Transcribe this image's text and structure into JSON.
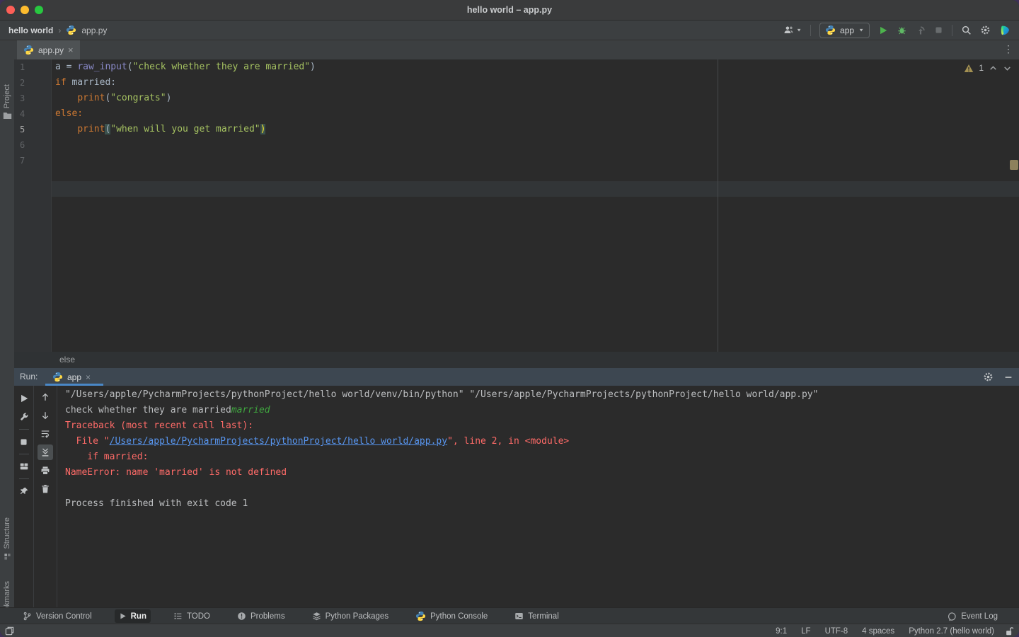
{
  "window": {
    "title": "hello world – app.py"
  },
  "navbar": {
    "project": "hello world",
    "separator": "›",
    "file": "app.py",
    "run_config": "app"
  },
  "tabbar": {
    "tab": "app.py",
    "close": "×",
    "more": "⋮"
  },
  "stripe": {
    "items": [
      {
        "label": "Project",
        "icon": "folder"
      },
      {
        "label": "Structure",
        "icon": "structure"
      },
      {
        "label": "Bookmarks",
        "icon": "bookmark"
      }
    ]
  },
  "editor": {
    "active_line": 5,
    "warning_count": "1",
    "breadcrumb": "else",
    "lines": [
      {
        "num": "1",
        "segs": [
          {
            "t": "a = ",
            "c": "plain"
          },
          {
            "t": "raw_input",
            "c": "builtin"
          },
          {
            "t": "(",
            "c": "plain"
          },
          {
            "t": "\"check whether they are married\"",
            "c": "string"
          },
          {
            "t": ")",
            "c": "plain"
          }
        ]
      },
      {
        "num": "2",
        "segs": [
          {
            "t": "if",
            "c": "keyword"
          },
          {
            "t": " married:",
            "c": "plain"
          }
        ]
      },
      {
        "num": "3",
        "segs": [
          {
            "t": "    ",
            "c": "plain"
          },
          {
            "t": "print",
            "c": "keyword"
          },
          {
            "t": "(",
            "c": "plain"
          },
          {
            "t": "\"congrats\"",
            "c": "string"
          },
          {
            "t": ")",
            "c": "plain"
          }
        ]
      },
      {
        "num": "4",
        "segs": [
          {
            "t": "else:",
            "c": "keyword"
          }
        ]
      },
      {
        "num": "5",
        "segs": [
          {
            "t": "    ",
            "c": "plain"
          },
          {
            "t": "print",
            "c": "keyword"
          },
          {
            "t": "(",
            "c": "paren"
          },
          {
            "t": "\"when will you get married\"",
            "c": "string"
          },
          {
            "t": ")",
            "c": "paren_y"
          }
        ]
      },
      {
        "num": "6",
        "segs": []
      },
      {
        "num": "7",
        "segs": []
      }
    ]
  },
  "run_panel": {
    "label": "Run:",
    "tab": "app",
    "close": "×",
    "toolbar_left": [
      {
        "icon": "rerun",
        "style": "green",
        "name": "rerun-button"
      },
      {
        "icon": "wrench",
        "style": "",
        "name": "edit-configuration-button"
      },
      {
        "icon": "sep",
        "style": "",
        "name": "separator"
      },
      {
        "icon": "stop",
        "style": "dim",
        "name": "stop-button"
      },
      {
        "icon": "sep",
        "style": "",
        "name": "separator"
      },
      {
        "icon": "layout",
        "style": "",
        "name": "restore-layout-button"
      },
      {
        "icon": "sep",
        "style": "",
        "name": "separator"
      },
      {
        "icon": "pin",
        "style": "",
        "name": "pin-tab-button"
      }
    ],
    "toolbar_right": [
      {
        "icon": "arrow-up",
        "style": "",
        "name": "up-stacktrace-button"
      },
      {
        "icon": "arrow-down",
        "style": "",
        "name": "down-stacktrace-button"
      },
      {
        "icon": "soft-wrap",
        "style": "",
        "name": "soft-wrap-button"
      },
      {
        "icon": "scroll-end",
        "style": "selected",
        "name": "scroll-to-end-button"
      },
      {
        "icon": "printer",
        "style": "",
        "name": "print-button"
      },
      {
        "icon": "trash",
        "style": "",
        "name": "clear-all-button"
      }
    ],
    "console": [
      {
        "segs": [
          {
            "t": "\"/Users/apple/PycharmProjects/pythonProject/hello world/venv/bin/python\" \"/Users/apple/PycharmProjects/pythonProject/hello world/app.py\"",
            "c": "stdout"
          }
        ]
      },
      {
        "segs": [
          {
            "t": "check whether they are married",
            "c": "stdout"
          },
          {
            "t": "married",
            "c": "input"
          }
        ]
      },
      {
        "segs": [
          {
            "t": "Traceback (most recent call last):",
            "c": "error"
          }
        ]
      },
      {
        "segs": [
          {
            "t": "  File \"",
            "c": "error"
          },
          {
            "t": "/Users/apple/PycharmProjects/pythonProject/hello world/app.py",
            "c": "link"
          },
          {
            "t": "\", line 2, in <module>",
            "c": "error"
          }
        ]
      },
      {
        "segs": [
          {
            "t": "    if married:",
            "c": "error"
          }
        ]
      },
      {
        "segs": [
          {
            "t": "NameError: name 'married' is not defined",
            "c": "error"
          }
        ]
      },
      {
        "segs": []
      },
      {
        "segs": [
          {
            "t": "Process finished with exit code 1",
            "c": "stdout"
          }
        ]
      }
    ]
  },
  "bottom_bar": {
    "items": [
      {
        "label": "Version Control",
        "icon": "git-branch",
        "active": false
      },
      {
        "label": "Run",
        "icon": "play-small",
        "active": true
      },
      {
        "label": "TODO",
        "icon": "todo",
        "active": false
      },
      {
        "label": "Problems",
        "icon": "error-circle",
        "active": false
      },
      {
        "label": "Python Packages",
        "icon": "layers",
        "active": false
      },
      {
        "label": "Python Console",
        "icon": "python",
        "active": false
      },
      {
        "label": "Terminal",
        "icon": "terminal",
        "active": false
      }
    ],
    "event_log": "Event Log"
  },
  "status_bar": {
    "items": [
      "9:1",
      "LF",
      "UTF-8",
      "4 spaces",
      "Python 2.7 (hello world)"
    ]
  },
  "colors": {
    "accent_blue": "#4a88c7",
    "run_green": "#4db34d",
    "error_red": "#ff6b68",
    "link_blue": "#5896f0",
    "string_green": "#a5c261",
    "keyword_orange": "#cc7832",
    "warning_olive": "#a49152"
  }
}
